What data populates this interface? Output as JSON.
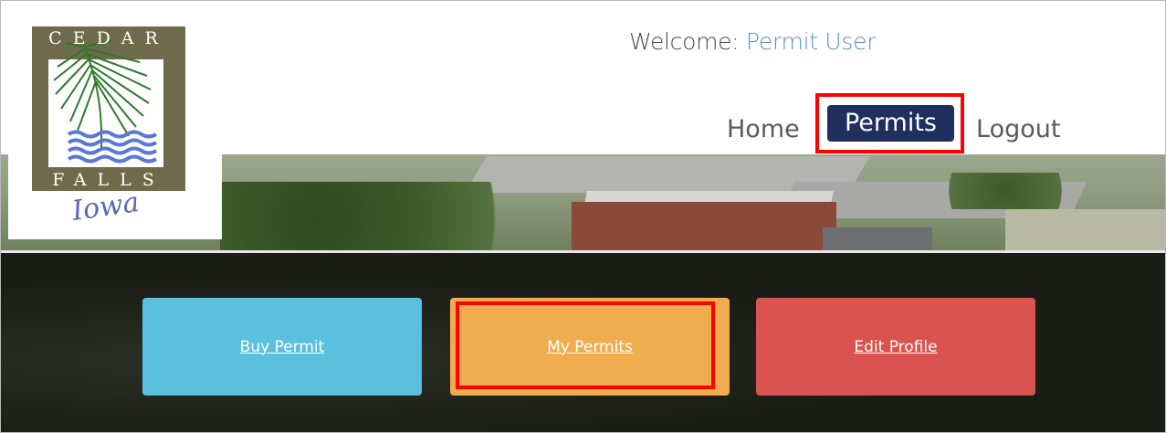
{
  "header": {
    "welcome_label": "Welcome:",
    "user_name": "Permit User"
  },
  "logo": {
    "top_text": "CEDAR",
    "bottom_text": "FALLS",
    "script_text": "Iowa"
  },
  "nav": {
    "home_label": "Home",
    "permits_label": "Permits",
    "logout_label": "Logout",
    "active": "Permits"
  },
  "tiles": {
    "buy_label": "Buy Permit",
    "my_label": "My Permits",
    "edit_label": "Edit Profile"
  },
  "colors": {
    "nav_active_bg": "#1f2f5e",
    "buy_tile": "#5bc0de",
    "my_tile": "#f0ad4e",
    "edit_tile": "#d9534f",
    "highlight": "#ff0000",
    "user_link": "#5b8fc4"
  }
}
